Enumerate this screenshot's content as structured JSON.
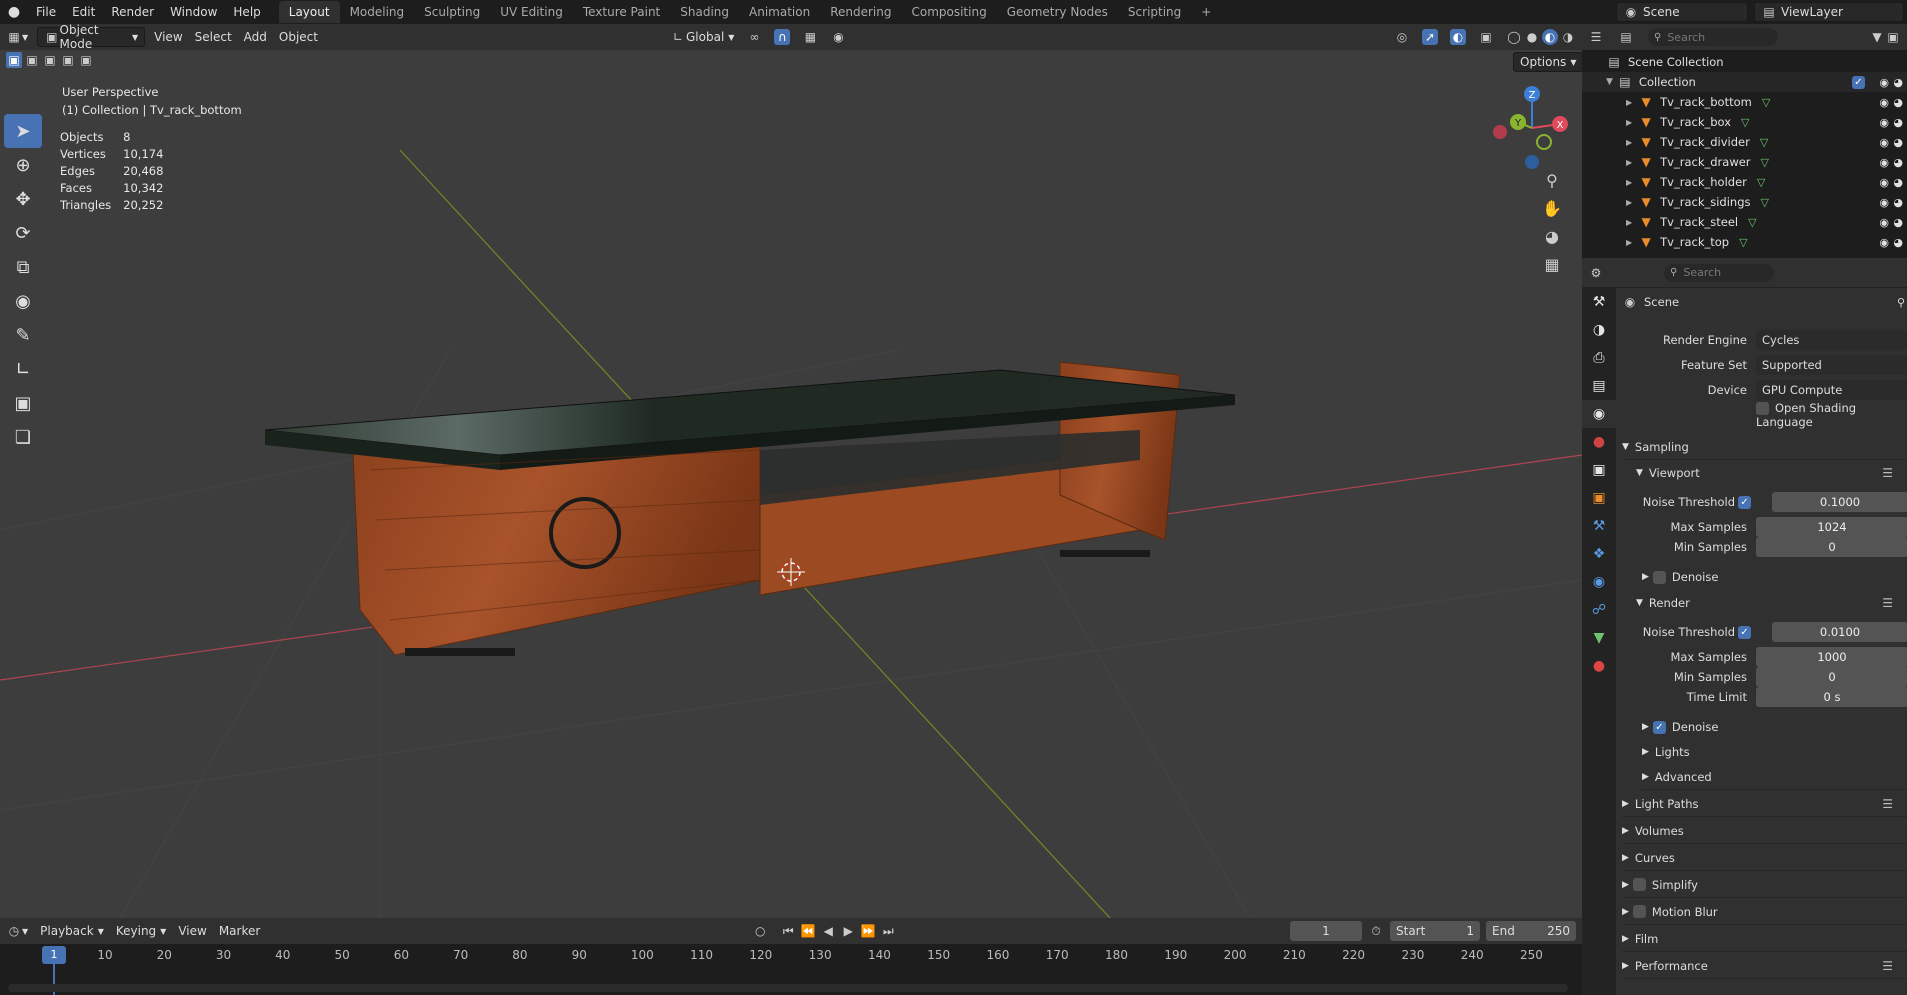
{
  "topbar": {
    "menus": [
      "File",
      "Edit",
      "Render",
      "Window",
      "Help"
    ],
    "workspaces": [
      "Layout",
      "Modeling",
      "Sculpting",
      "UV Editing",
      "Texture Paint",
      "Shading",
      "Animation",
      "Rendering",
      "Compositing",
      "Geometry Nodes",
      "Scripting"
    ],
    "active_workspace": "Layout",
    "add_tab": "+",
    "scene": "Scene",
    "view_layer": "ViewLayer"
  },
  "viewport_header": {
    "mode": "Object Mode",
    "menus": [
      "View",
      "Select",
      "Add",
      "Object"
    ],
    "transform_orientation": "Global",
    "options": "Options"
  },
  "overlay": {
    "perspective": "User Perspective",
    "collection": "(1) Collection | Tv_rack_bottom",
    "stats": [
      {
        "label": "Objects",
        "value": "8"
      },
      {
        "label": "Vertices",
        "value": "10,174"
      },
      {
        "label": "Edges",
        "value": "20,468"
      },
      {
        "label": "Faces",
        "value": "10,342"
      },
      {
        "label": "Triangles",
        "value": "20,252"
      }
    ],
    "gizmo": {
      "x": "X",
      "y": "Y",
      "z": "Z"
    }
  },
  "timeline": {
    "menus": [
      "Playback",
      "Keying",
      "View",
      "Marker"
    ],
    "current_frame": "1",
    "start_label": "Start",
    "start": "1",
    "end_label": "End",
    "end": "250",
    "ticks": [
      "1",
      "10",
      "20",
      "30",
      "40",
      "50",
      "60",
      "70",
      "80",
      "90",
      "100",
      "110",
      "120",
      "130",
      "140",
      "150",
      "160",
      "170",
      "180",
      "190",
      "200",
      "210",
      "220",
      "230",
      "240",
      "250"
    ]
  },
  "outliner": {
    "search_placeholder": "Search",
    "root": "Scene Collection",
    "collection": "Collection",
    "items": [
      "Tv_rack_bottom",
      "Tv_rack_box",
      "Tv_rack_divider",
      "Tv_rack_drawer",
      "Tv_rack_holder",
      "Tv_rack_sidings",
      "Tv_rack_steel",
      "Tv_rack_top"
    ]
  },
  "properties": {
    "search_placeholder": "Search",
    "context": "Scene",
    "render_engine_label": "Render Engine",
    "render_engine": "Cycles",
    "feature_set_label": "Feature Set",
    "feature_set": "Supported",
    "device_label": "Device",
    "device": "GPU Compute",
    "osl": "Open Shading Language",
    "sampling": "Sampling",
    "viewport": "Viewport",
    "noise_threshold_label": "Noise Threshold",
    "vp_noise_threshold": "0.1000",
    "max_samples_label": "Max Samples",
    "vp_max_samples": "1024",
    "min_samples_label": "Min Samples",
    "vp_min_samples": "0",
    "denoise": "Denoise",
    "render": "Render",
    "r_noise_threshold": "0.0100",
    "r_max_samples": "1000",
    "r_min_samples": "0",
    "time_limit_label": "Time Limit",
    "r_time_limit": "0 s",
    "lights": "Lights",
    "advanced": "Advanced",
    "panels": [
      "Light Paths",
      "Volumes",
      "Curves",
      "Simplify",
      "Motion Blur",
      "Film",
      "Performance"
    ]
  },
  "colors": {
    "accent": "#4772b3",
    "x_axis": "#e04a5a",
    "y_axis": "#8ab531",
    "z_axis": "#3c7ed8",
    "wood": "#9a4a22"
  }
}
